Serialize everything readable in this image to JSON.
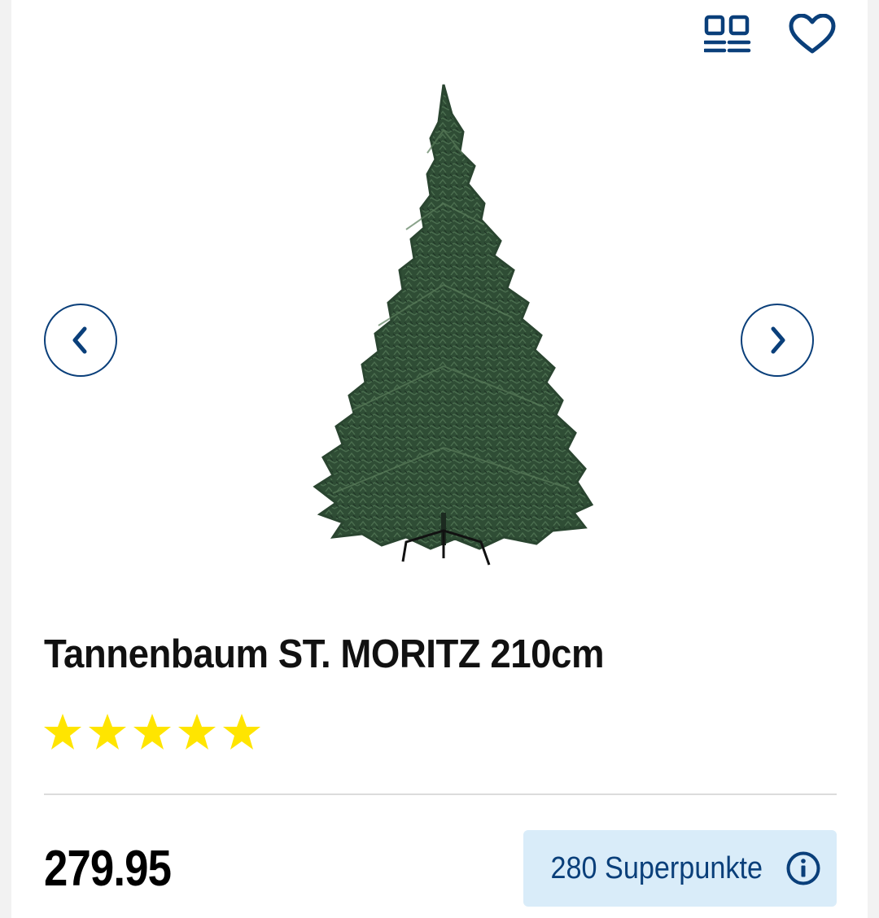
{
  "header": {
    "compare_icon": "compare-icon",
    "wishlist_icon": "heart-icon"
  },
  "gallery": {
    "prev_icon": "chevron-left-icon",
    "next_icon": "chevron-right-icon",
    "image": "christmas-tree-product-image"
  },
  "product": {
    "title": "Tannenbaum ST. MORITZ 210cm",
    "rating": {
      "value": 5,
      "max": 5,
      "star_color": "#ffe500"
    },
    "price": "279.95",
    "points_label": "280 Superpunkte",
    "points_info_icon": "info-icon"
  },
  "colors": {
    "brand_blue": "#0a3f7a",
    "points_bg": "#d9ecf9"
  }
}
